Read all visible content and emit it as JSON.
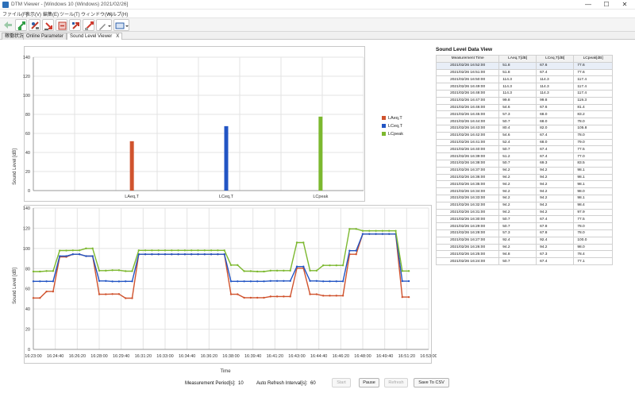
{
  "window": {
    "title": "DTM Viewer - [Windows 10 (Windows) 2021/02/26]",
    "minimize": "—",
    "maximize": "☐",
    "close": "✕"
  },
  "menu": [
    "ファイル(F)",
    "表示(V)",
    "編集(E)",
    "ツール(T)",
    "ウィンドウ(W)",
    "ヘルプ(H)"
  ],
  "toolbar": {
    "icons": [
      "back-icon",
      "connect-icon",
      "import-icon",
      "download-icon",
      "export-icon",
      "upload-icon",
      "settings-icon",
      "pen-icon",
      "display-icon"
    ],
    "colors": [
      "#3aa05a",
      "#2f9e44",
      "#c0392b",
      "#d03b2f",
      "#c0392b",
      "#c0392b",
      "#d03b2f",
      "#777777",
      "#2c5fa8"
    ]
  },
  "tabs": [
    {
      "label": "稼働状況",
      "active": false
    },
    {
      "label": "Online Parameter",
      "active": false
    },
    {
      "label": "Sound Level Viewer",
      "active": true,
      "close": "X"
    }
  ],
  "bar_chart": {
    "ylabel": "Sound Level [dB]",
    "yticks": [
      "0",
      "20",
      "40",
      "60",
      "80",
      "100",
      "120",
      "140"
    ],
    "legend": [
      {
        "name": "LAeq,T",
        "color": "#d0532e"
      },
      {
        "name": "LCeq,T",
        "color": "#2255c4"
      },
      {
        "name": "LCpeak",
        "color": "#7cb82f"
      }
    ]
  },
  "line_chart": {
    "ylabel": "Sound Level [dB]",
    "xlabel": "Time",
    "yticks": [
      "0",
      "20",
      "40",
      "60",
      "80",
      "100",
      "120",
      "140"
    ],
    "xticks": [
      "16:23:00",
      "16:24:40",
      "16:26:20",
      "16:28:00",
      "16:29:40",
      "16:31:20",
      "16:33:00",
      "16:34:40",
      "16:36:20",
      "16:38:00",
      "16:39:40",
      "16:41:20",
      "16:43:00",
      "16:44:40",
      "16:46:20",
      "16:48:00",
      "16:49:40",
      "16:51:20",
      "16:53:00"
    ]
  },
  "chart_data": [
    {
      "type": "bar",
      "categories": [
        "LAeq,T",
        "LCeq,T",
        "LCpeak"
      ],
      "values": [
        51.8,
        67.6,
        77.6
      ],
      "colors": [
        "#d0532e",
        "#2255c4",
        "#7cb82f"
      ],
      "xlabel": "",
      "ylabel": "Sound Level [dB]",
      "ylim": [
        0,
        140
      ],
      "grid": true,
      "legend": "right"
    },
    {
      "type": "line",
      "x": [
        "16:23:00",
        "16:23:30",
        "16:24:00",
        "16:24:30",
        "16:25:00",
        "16:25:30",
        "16:26:00",
        "16:26:30",
        "16:27:00",
        "16:27:30",
        "16:28:00",
        "16:28:30",
        "16:29:00",
        "16:29:30",
        "16:30:00",
        "16:30:30",
        "16:31:00",
        "16:31:30",
        "16:32:00",
        "16:32:30",
        "16:33:00",
        "16:33:30",
        "16:34:00",
        "16:34:30",
        "16:35:00",
        "16:35:30",
        "16:36:00",
        "16:36:30",
        "16:37:00",
        "16:37:30",
        "16:38:00",
        "16:38:30",
        "16:39:00",
        "16:39:30",
        "16:40:00",
        "16:40:30",
        "16:41:00",
        "16:41:30",
        "16:42:00",
        "16:42:30",
        "16:43:00",
        "16:43:30",
        "16:44:00",
        "16:44:30",
        "16:45:00",
        "16:45:30",
        "16:46:00",
        "16:46:30",
        "16:47:00",
        "16:47:30",
        "16:48:00",
        "16:48:30",
        "16:49:00",
        "16:49:30",
        "16:50:00",
        "16:50:30",
        "16:51:00",
        "16:51:30"
      ],
      "series": [
        {
          "name": "LAeq,T",
          "color": "#d0532e",
          "values": [
            50.9,
            50.9,
            57.3,
            57.3,
            91.6,
            91.6,
            94.2,
            94.2,
            92.4,
            92.4,
            54.6,
            54.6,
            54.8,
            54.8,
            50.7,
            50.7,
            94.2,
            94.2,
            94.2,
            94.2,
            94.2,
            94.2,
            94.2,
            94.2,
            94.2,
            94.2,
            94.2,
            94.2,
            94.2,
            94.2,
            54.6,
            54.6,
            51.2,
            51.2,
            51.2,
            51.2,
            52.4,
            52.4,
            52.4,
            52.4,
            80.4,
            80.4,
            54.6,
            54.6,
            53.2,
            53.2,
            53.2,
            53.2,
            94.2,
            94.2,
            114.3,
            114.3,
            114.3,
            114.3,
            114.3,
            114.3,
            51.8,
            51.8
          ]
        },
        {
          "name": "LCeq,T",
          "color": "#2255c4",
          "values": [
            67.4,
            67.4,
            67.4,
            67.4,
            92.4,
            92.4,
            94.2,
            94.2,
            92.4,
            92.4,
            67.8,
            67.8,
            67.3,
            67.3,
            67.4,
            67.4,
            94.2,
            94.2,
            94.2,
            94.2,
            94.2,
            94.2,
            94.2,
            94.2,
            94.2,
            94.2,
            94.2,
            94.2,
            94.2,
            94.2,
            67.4,
            67.4,
            67.4,
            67.4,
            67.4,
            67.4,
            67.8,
            67.8,
            67.8,
            67.8,
            82.0,
            82.0,
            67.8,
            67.8,
            67.4,
            67.4,
            67.4,
            67.4,
            97.8,
            97.8,
            114.3,
            114.3,
            114.3,
            114.3,
            114.3,
            114.3,
            67.6,
            67.6
          ]
        },
        {
          "name": "LCpeak",
          "color": "#7cb82f",
          "values": [
            77.1,
            77.1,
            77.6,
            77.6,
            97.9,
            97.9,
            98.1,
            98.1,
            100.0,
            100.0,
            78.0,
            78.0,
            78.4,
            78.4,
            77.5,
            77.5,
            98.1,
            98.1,
            98.1,
            98.1,
            98.1,
            98.1,
            98.1,
            98.1,
            98.1,
            98.1,
            98.1,
            98.1,
            98.1,
            98.1,
            83.5,
            83.5,
            77.5,
            77.5,
            77.1,
            77.1,
            78.0,
            78.0,
            78.0,
            78.0,
            105.8,
            105.8,
            78.0,
            78.0,
            83.2,
            83.2,
            83.2,
            83.2,
            119.3,
            119.3,
            117.4,
            117.4,
            117.4,
            117.4,
            117.4,
            117.4,
            77.6,
            77.6
          ]
        }
      ],
      "xlabel": "Time",
      "ylabel": "Sound Level [dB]",
      "ylim": [
        0,
        140
      ],
      "grid": true
    }
  ],
  "table": {
    "title": "Sound Level Data View",
    "columns": [
      "Measurement Time",
      "LAeq,T[dB]",
      "LCeq,T[dB]",
      "LCpeak[dB]"
    ],
    "rows": [
      [
        "2021/02/26 16:52:00",
        "51.8",
        "67.6",
        "77.6"
      ],
      [
        "2021/02/26 16:51:00",
        "51.8",
        "67.4",
        "77.6"
      ],
      [
        "2021/02/26 16:50:00",
        "114.3",
        "114.3",
        "117.4"
      ],
      [
        "2021/02/26 16:49:00",
        "114.3",
        "114.3",
        "117.4"
      ],
      [
        "2021/02/26 16:48:00",
        "114.3",
        "114.3",
        "117.4"
      ],
      [
        "2021/02/26 16:47:00",
        "99.8",
        "99.8",
        "119.3"
      ],
      [
        "2021/02/26 16:46:00",
        "54.6",
        "67.6",
        "81.4"
      ],
      [
        "2021/02/26 16:45:00",
        "57.3",
        "68.0",
        "83.2"
      ],
      [
        "2021/02/26 16:44:00",
        "50.7",
        "68.0",
        "78.0"
      ],
      [
        "2021/02/26 16:43:00",
        "80.4",
        "82.0",
        "105.8"
      ],
      [
        "2021/02/26 16:42:00",
        "54.6",
        "67.4",
        "78.0"
      ],
      [
        "2021/02/26 16:41:00",
        "52.4",
        "68.0",
        "79.0"
      ],
      [
        "2021/02/26 16:40:00",
        "50.7",
        "67.4",
        "77.5"
      ],
      [
        "2021/02/26 16:39:00",
        "51.2",
        "67.4",
        "77.0"
      ],
      [
        "2021/02/26 16:38:00",
        "50.7",
        "69.3",
        "83.5"
      ],
      [
        "2021/02/26 16:37:00",
        "94.2",
        "94.2",
        "98.1"
      ],
      [
        "2021/02/26 16:36:00",
        "94.2",
        "94.2",
        "98.1"
      ],
      [
        "2021/02/26 16:35:00",
        "94.2",
        "94.2",
        "98.1"
      ],
      [
        "2021/02/26 16:34:00",
        "94.2",
        "94.2",
        "98.0"
      ],
      [
        "2021/02/26 16:33:00",
        "94.2",
        "94.2",
        "98.1"
      ],
      [
        "2021/02/26 16:32:00",
        "94.2",
        "94.2",
        "98.4"
      ],
      [
        "2021/02/26 16:31:00",
        "94.2",
        "94.2",
        "97.9"
      ],
      [
        "2021/02/26 16:30:00",
        "50.7",
        "67.4",
        "77.5"
      ],
      [
        "2021/02/26 16:29:00",
        "50.7",
        "67.8",
        "78.0"
      ],
      [
        "2021/02/26 16:28:00",
        "57.3",
        "67.8",
        "78.0"
      ],
      [
        "2021/02/26 16:27:00",
        "92.4",
        "92.4",
        "100.0"
      ],
      [
        "2021/02/26 16:26:00",
        "94.2",
        "94.2",
        "98.0"
      ],
      [
        "2021/02/26 16:25:00",
        "94.8",
        "67.3",
        "78.4"
      ],
      [
        "2021/02/26 16:24:00",
        "50.7",
        "67.4",
        "77.1"
      ]
    ]
  },
  "controls": {
    "period_label": "Measurement Period[s]:",
    "period_value": "10",
    "refresh_label": "Auto Refresh Interval[s]:",
    "refresh_value": "60",
    "start": "Start",
    "pause": "Pause",
    "refresh": "Refresh",
    "save_csv": "Save To CSV"
  }
}
